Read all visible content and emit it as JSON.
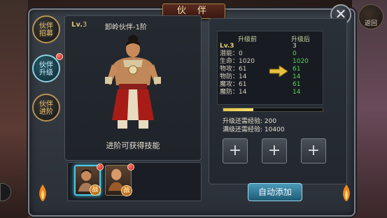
{
  "window": {
    "title": "伙 伴"
  },
  "top_right": {
    "close_label": "✕",
    "return_label": "返回"
  },
  "side_tabs": [
    {
      "label_line1": "伙伴",
      "label_line2": "招募",
      "active": false,
      "badge": false
    },
    {
      "label_line1": "伙伴",
      "label_line2": "升级",
      "active": true,
      "badge": true
    },
    {
      "label_line1": "伙伴",
      "label_line2": "进阶",
      "active": false,
      "badge": false
    }
  ],
  "unit": {
    "level_prefix": "Lv.",
    "level": "3",
    "name": "卸岭伙伴-1阶",
    "skill_hint": "进阶可获得技能"
  },
  "roster": [
    {
      "badge": "战",
      "selected": true,
      "alert": true
    },
    {
      "badge": "战",
      "selected": false,
      "alert": true
    }
  ],
  "stats": {
    "before_header": "升级前",
    "after_header": "升级后",
    "rows": [
      {
        "label": "Lv.",
        "before": "3",
        "after": "3",
        "changed": false,
        "is_level": true
      },
      {
        "label": "潜能：",
        "before": "0",
        "after": "0",
        "changed": true
      },
      {
        "label": "生命：",
        "before": "1020",
        "after": "1020",
        "changed": true
      },
      {
        "label": "物攻：",
        "before": "61",
        "after": "61",
        "changed": true
      },
      {
        "label": "物防：",
        "before": "14",
        "after": "14",
        "changed": true
      },
      {
        "label": "魔攻：",
        "before": "61",
        "after": "61",
        "changed": true
      },
      {
        "label": "魔防：",
        "before": "14",
        "after": "14",
        "changed": true
      }
    ]
  },
  "exp": {
    "progress_fraction": 0.3,
    "next_label": "升级还需经验:",
    "next_value": "200",
    "max_label": "满级还需经验:",
    "max_value": "10400"
  },
  "material_slots": [
    {
      "glyph": "+"
    },
    {
      "glyph": "+"
    },
    {
      "glyph": "+"
    }
  ],
  "auto_add_label": "自动添加"
}
